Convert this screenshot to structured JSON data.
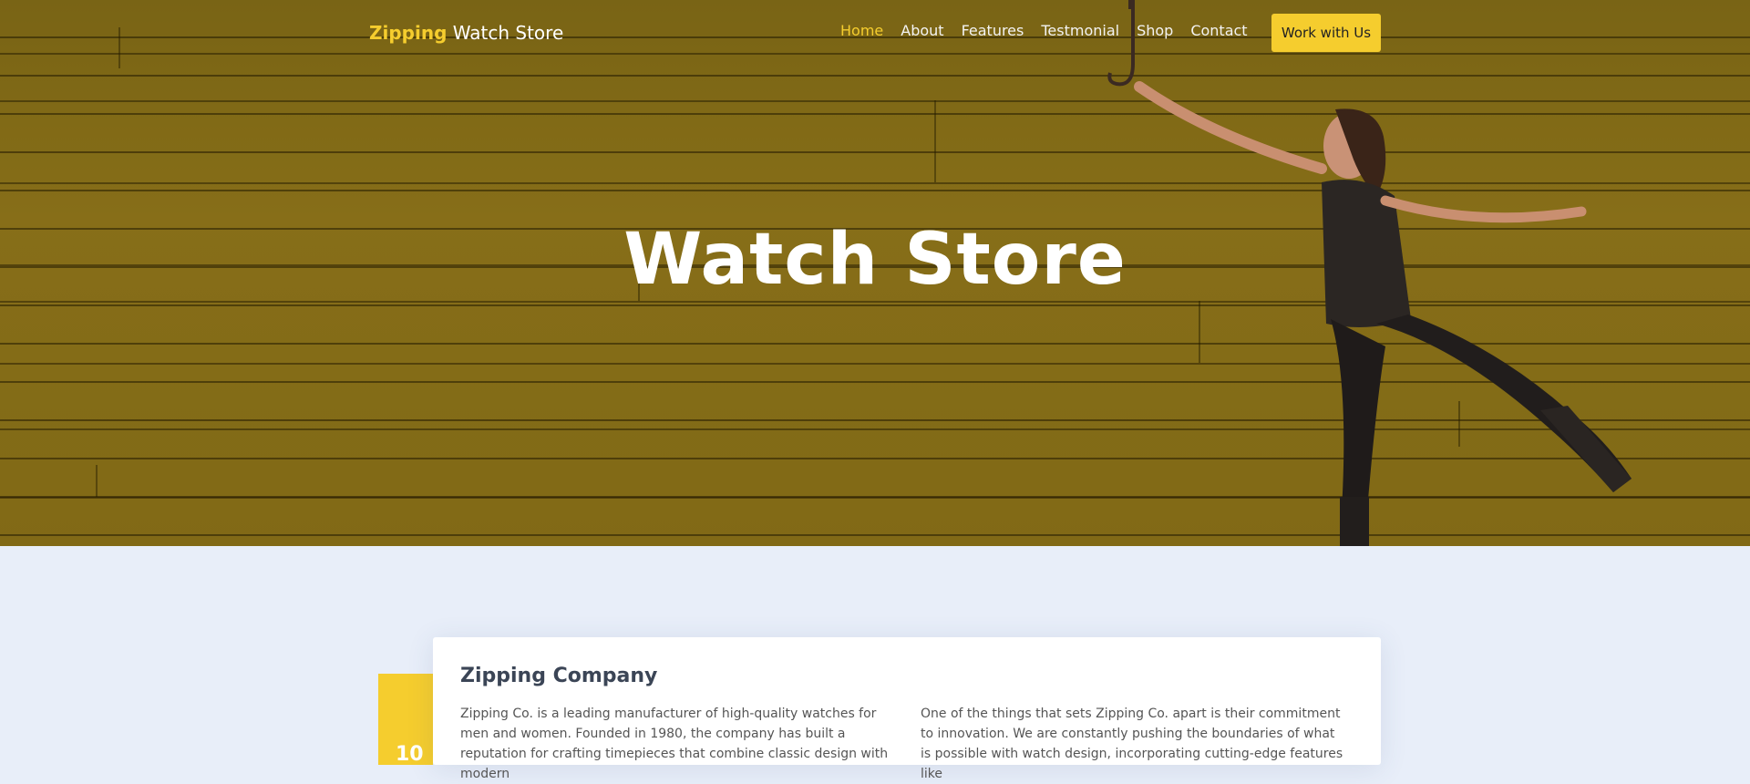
{
  "brand": {
    "accent": "Zipping",
    "rest": " Watch Store"
  },
  "nav": {
    "items": [
      "Home",
      "About",
      "Features",
      "Testmonial",
      "Shop",
      "Contact"
    ],
    "active_index": 0,
    "cta_label": "Work with Us"
  },
  "hero": {
    "title": "Watch Store"
  },
  "about_card": {
    "title": "Zipping Company",
    "accent_text": "10",
    "column1": "Zipping Co. is a leading manufacturer of high-quality watches for men and women. Founded in 1980, the company has built a reputation for crafting timepieces that combine classic design with modern",
    "column2": "One of the things that sets Zipping Co. apart is their commitment to innovation. We are constantly pushing the boundaries of what is possible with watch design, incorporating cutting-edge features like"
  },
  "colors": {
    "accent": "#f5cd2e",
    "page_bg": "#e8eef9",
    "hero_tint": "#8a7218"
  },
  "icons": {
    "hero_figure": "woman-with-umbrella-illustration"
  }
}
